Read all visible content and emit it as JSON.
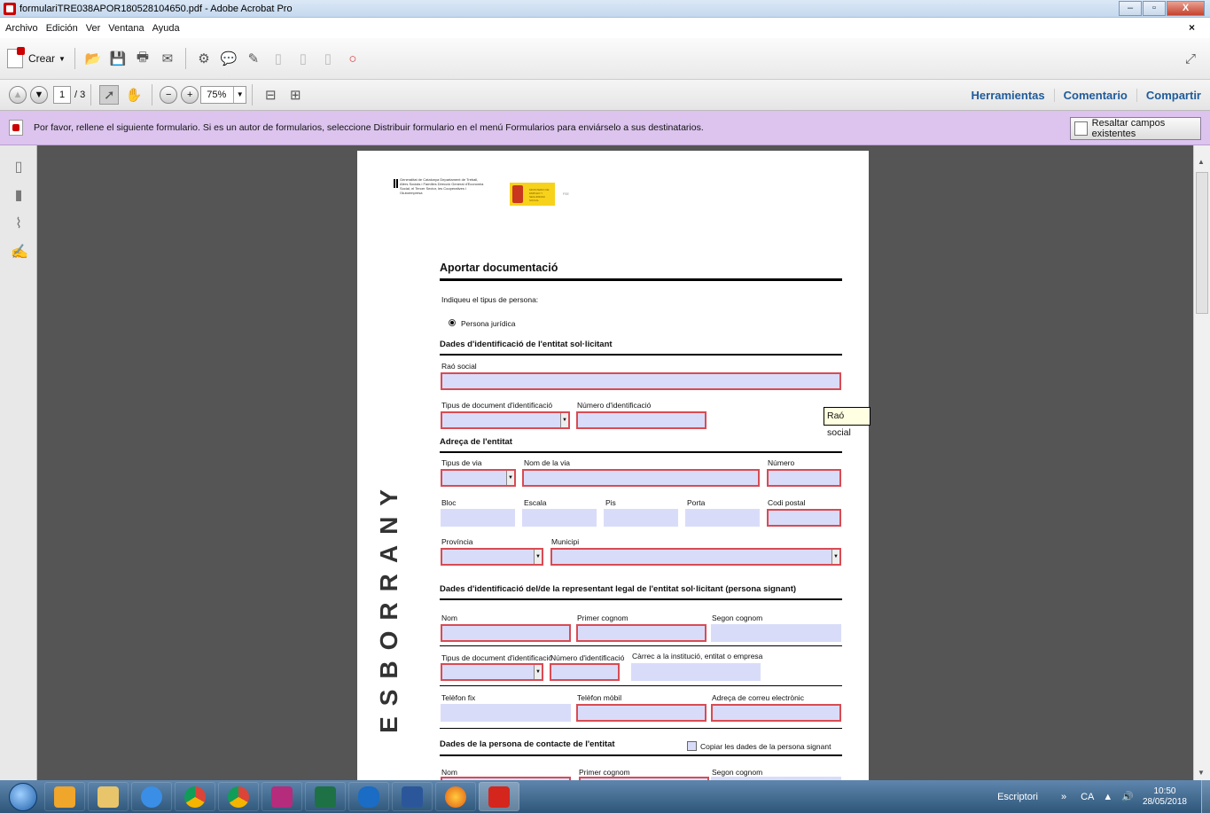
{
  "window": {
    "title": "formulariTRE038APOR180528104650.pdf - Adobe Acrobat Pro",
    "min": "–",
    "max": "▫",
    "close": "X"
  },
  "menu": {
    "items": [
      "Archivo",
      "Edición",
      "Ver",
      "Ventana",
      "Ayuda"
    ],
    "close": "×"
  },
  "toolbar": {
    "crear_label": "Crear",
    "page_current": "1",
    "page_total": "/ 3",
    "zoom": "75%",
    "right_links": [
      "Herramientas",
      "Comentario",
      "Compartir"
    ]
  },
  "form_bar": {
    "message": "Por favor, rellene el siguiente formulario. Si es un autor de formularios, seleccione Distribuir formulario en el menú Formularios para enviárselo a sus destinatarios.",
    "highlight_button": "Resaltar campos existentes"
  },
  "document": {
    "header_gencat": "Generalitat de Catalunya Departament de Treball, Afers Socials i Famílies Direcció General d'Economia Social, el Tercer Sector, les Cooperatives i l'Autoempresa",
    "header_ministerio": "MINISTERIO DE EMPLEO Y SEGURIDAD SOCIAL",
    "header_fse": "FSE",
    "title": "Aportar documentació",
    "person_type_prompt": "Indiqueu el tipus de persona:",
    "person_type_value": "Persona jurídica",
    "section1": "Dades d'identificació de l'entitat sol·licitant",
    "rao_social": "Raó social",
    "tipus_doc": "Tipus de document d'identificació",
    "num_ident": "Número d'identificació",
    "section2": "Adreça de l'entitat",
    "tipus_via": "Tipus de via",
    "nom_via": "Nom de la via",
    "numero": "Número",
    "bloc": "Bloc",
    "escala": "Escala",
    "pis": "Pis",
    "porta": "Porta",
    "codi_postal": "Codi postal",
    "provincia": "Província",
    "municipi": "Municipi",
    "section3": "Dades d'identificació del/de la representant legal de l'entitat sol·licitant (persona signant)",
    "nom": "Nom",
    "primer_cognom": "Primer cognom",
    "segon_cognom": "Segon cognom",
    "tipus_doc2": "Tipus de document d'identificació",
    "num_ident2": "Número d'identificació",
    "carrec": "Càrrec a la institució, entitat o empresa",
    "telefon_fix": "Telèfon fix",
    "telefon_mobil": "Telèfon mòbil",
    "correu": "Adreça de correu electrònic",
    "section4": "Dades de la persona de contacte de l'entitat",
    "copiar": "Copiar les dades de la persona signant",
    "nom2": "Nom",
    "primer_cognom2": "Primer cognom",
    "segon_cognom2": "Segon cognom",
    "watermark": "ESBORRANY"
  },
  "tooltip": "Raó social",
  "taskbar": {
    "desktop_label": "Escriptori",
    "chevron": "»",
    "lang": "CA",
    "time": "10:50",
    "date": "28/05/2018"
  },
  "colors": {
    "form_bar": "#dcc4ee",
    "required_border": "#d94b53",
    "field_fill": "#d9dcf9",
    "link_blue": "#1f5b9a",
    "viewer_bg": "#555555"
  }
}
